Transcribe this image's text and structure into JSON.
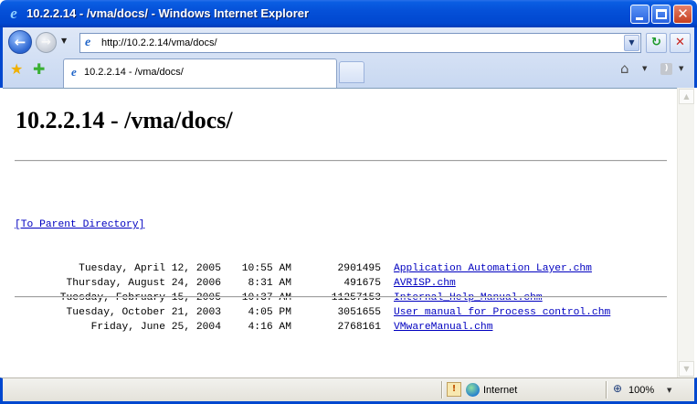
{
  "window": {
    "title": "10.2.2.14 - /vma/docs/ - Windows Internet Explorer",
    "controls": {
      "minimize": "",
      "maximize": "",
      "close": "✕"
    }
  },
  "toolbar": {
    "back": "←",
    "forward": "→",
    "address_url": "http://10.2.2.14/vma/docs/",
    "refresh": "↻",
    "stop": "✕"
  },
  "tabs": [
    {
      "label": "10.2.2.14 - /vma/docs/"
    }
  ],
  "page": {
    "title": "10.2.2.14 - /vma/docs/",
    "parent_link": "[To Parent Directory]",
    "files": [
      {
        "date": "Tuesday, April 12, 2005",
        "time": "10:55 AM",
        "size": "2901495",
        "name": "Application Automation Layer.chm"
      },
      {
        "date": "Thursday, August 24, 2006",
        "time": "8:31 AM",
        "size": "491675",
        "name": "AVRISP.chm"
      },
      {
        "date": "Tuesday, February 15, 2005",
        "time": "10:37 AM",
        "size": "11257153",
        "name": "Internal_Help_Manual.chm"
      },
      {
        "date": "Tuesday, October 21, 2003",
        "time": "4:05 PM",
        "size": "3051655",
        "name": "User manual for Process control.chm"
      },
      {
        "date": "Friday, June 25, 2004",
        "time": "4:16 AM",
        "size": "2768161",
        "name": "VMwareManual.chm"
      }
    ]
  },
  "statusbar": {
    "zone": "Internet",
    "zoom": "100%"
  }
}
